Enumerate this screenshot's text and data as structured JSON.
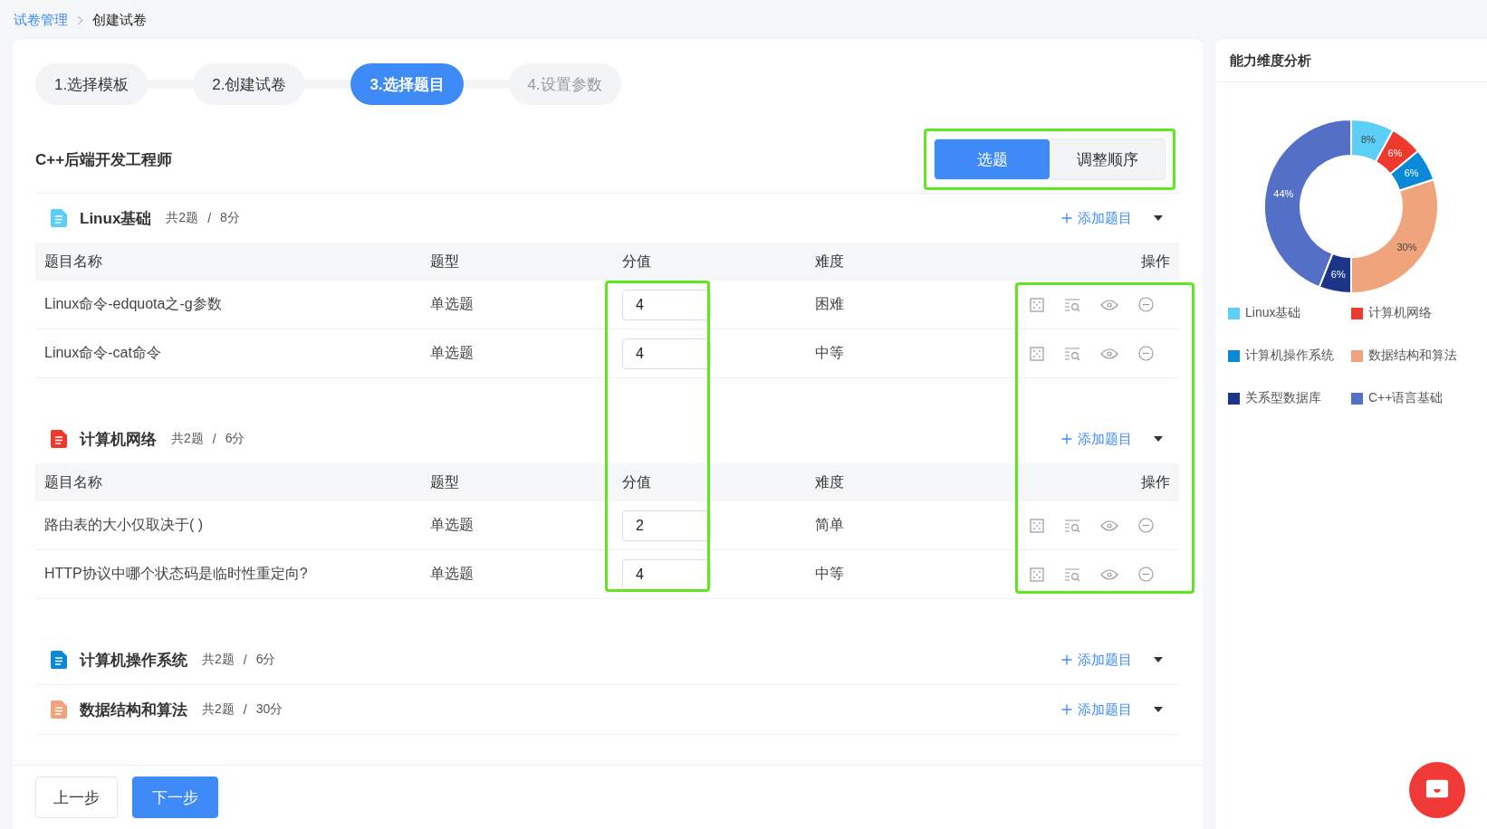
{
  "breadcrumb": [
    {
      "label": "试卷管理",
      "kind": "link"
    },
    {
      "label": "创建试卷",
      "kind": "current"
    }
  ],
  "steps": [
    {
      "label": "1.选择模板",
      "selected": false,
      "pending": false
    },
    {
      "label": "2.创建试卷",
      "selected": false,
      "pending": false
    },
    {
      "label": "3.选择题目",
      "selected": true,
      "pending": false
    },
    {
      "label": "4.设置参数",
      "selected": false,
      "pending": true
    }
  ],
  "paper_title": "C++后端开发工程师",
  "mode_toggle": [
    {
      "label": "选题",
      "selected": true
    },
    {
      "label": "调整顺序",
      "selected": false
    }
  ],
  "sections": [
    {
      "title": "Linux基础",
      "count": "共2题",
      "separator": "/",
      "score": "8分",
      "color": "#5bcff5",
      "add_label": "添加题目",
      "table": {
        "columns": [
          "题目名称",
          "题型",
          "分值",
          "难度",
          "操作"
        ],
        "rows": [
          {
            "name": "Linux命令-edquota之-g参数",
            "type": "单选题",
            "score": "4",
            "difficulty": "困难"
          },
          {
            "name": "Linux命令-cat命令",
            "type": "单选题",
            "score": "4",
            "difficulty": "中等"
          }
        ]
      }
    },
    {
      "title": "计算机网络",
      "count": "共2题",
      "separator": "/",
      "score": "6分",
      "color": "#ee3a2d",
      "add_label": "添加题目",
      "table": {
        "columns": [
          "题目名称",
          "题型",
          "分值",
          "难度",
          "操作"
        ],
        "rows": [
          {
            "name": "路由表的大小仅取决于( )",
            "type": "单选题",
            "score": "2",
            "difficulty": "简单"
          },
          {
            "name": "HTTP协议中哪个状态码是临时性重定向?",
            "type": "单选题",
            "score": "4",
            "difficulty": "中等"
          }
        ]
      }
    },
    {
      "title": "计算机操作系统",
      "count": "共2题",
      "separator": "/",
      "score": "6分",
      "color": "#0a8ad6",
      "add_label": "添加题目"
    },
    {
      "title": "数据结构和算法",
      "count": "共2题",
      "separator": "/",
      "score": "30分",
      "color": "#f0a47c",
      "add_label": "添加题目"
    }
  ],
  "buttons": {
    "prev": "上一步",
    "next": "下一步"
  },
  "ability_panel": {
    "title": "能力维度分析",
    "chart_data": {
      "type": "donut",
      "categories": [
        "Linux基础",
        "计算机网络",
        "计算机操作系统",
        "数据结构和算法",
        "关系型数据库",
        "C++语言基础"
      ],
      "values": [
        8,
        6,
        6,
        30,
        6,
        44
      ],
      "value_labels": [
        "8%",
        "6%",
        "6%",
        "30%",
        "6%",
        "44%"
      ]
    },
    "legend": [
      {
        "color": "#5bcff5"
      },
      {
        "color": "#ee3a2d"
      },
      {
        "color": "#0a8ad6"
      },
      {
        "color": "#f0a47c"
      },
      {
        "color": "#1d3588"
      },
      {
        "color": "#5470c6"
      }
    ]
  }
}
